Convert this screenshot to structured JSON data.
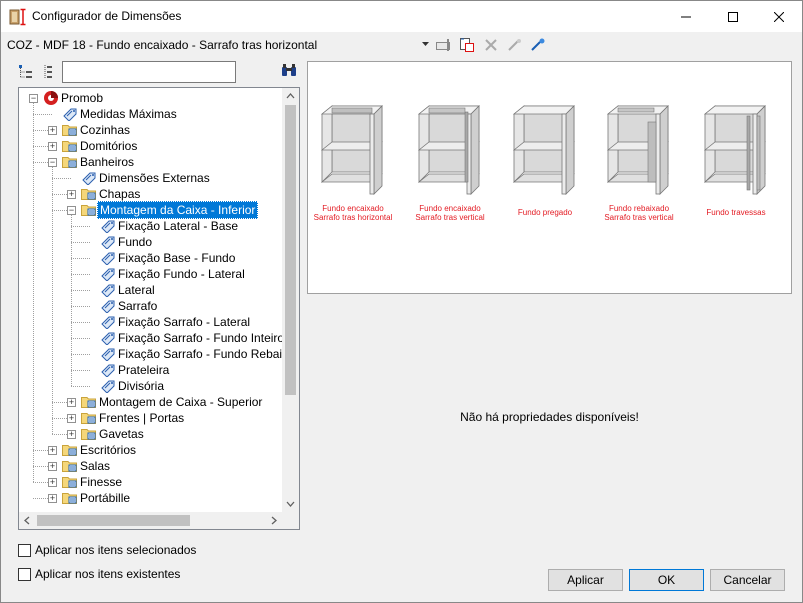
{
  "window": {
    "title": "Configurador de Dimensões"
  },
  "toolbar": {
    "combo_value": "COZ - MDF 18 - Fundo encaixado - Sarrafo tras horizontal"
  },
  "search": {
    "value": ""
  },
  "tree": {
    "items": [
      {
        "label": "Promob",
        "icon": "promob-logo-icon",
        "selected": false
      },
      {
        "label": "Medidas Máximas",
        "icon": "tag-icon"
      },
      {
        "label": "Cozinhas",
        "icon": "folder-icon"
      },
      {
        "label": "Domitórios",
        "icon": "folder-icon"
      },
      {
        "label": "Banheiros",
        "icon": "folder-icon"
      },
      {
        "label": "Dimensões Externas",
        "icon": "tag-icon"
      },
      {
        "label": "Chapas",
        "icon": "folder-icon"
      },
      {
        "label": "Montagem da Caixa - Inferior",
        "icon": "folder-icon",
        "selected": true
      },
      {
        "label": "Fixação Lateral - Base",
        "icon": "tag-icon"
      },
      {
        "label": "Fundo",
        "icon": "tag-icon"
      },
      {
        "label": "Fixação Base - Fundo",
        "icon": "tag-icon"
      },
      {
        "label": "Fixação Fundo - Lateral",
        "icon": "tag-icon"
      },
      {
        "label": "Lateral",
        "icon": "tag-icon"
      },
      {
        "label": "Sarrafo",
        "icon": "tag-icon"
      },
      {
        "label": "Fixação Sarrafo - Lateral",
        "icon": "tag-icon"
      },
      {
        "label": "Fixação Sarrafo - Fundo Inteiro",
        "icon": "tag-icon"
      },
      {
        "label": "Fixação Sarrafo - Fundo Rebaixado",
        "icon": "tag-icon"
      },
      {
        "label": "Prateleira",
        "icon": "tag-icon"
      },
      {
        "label": "Divisória",
        "icon": "tag-icon"
      },
      {
        "label": "Montagem de Caixa - Superior",
        "icon": "folder-icon"
      },
      {
        "label": "Frentes | Portas",
        "icon": "folder-icon"
      },
      {
        "label": "Gavetas",
        "icon": "folder-icon"
      },
      {
        "label": "Escritórios",
        "icon": "folder-icon"
      },
      {
        "label": "Salas",
        "icon": "folder-icon"
      },
      {
        "label": "Finesse",
        "icon": "folder-icon"
      },
      {
        "label": "Portábille",
        "icon": "folder-icon"
      }
    ]
  },
  "preview": {
    "options": [
      {
        "caption_line1": "Fundo encaixado",
        "caption_line2": "Sarrafo tras horizontal"
      },
      {
        "caption_line1": "Fundo encaixado",
        "caption_line2": "Sarrafo tras vertical"
      },
      {
        "caption_line1": "Fundo pregado",
        "caption_line2": ""
      },
      {
        "caption_line1": "Fundo rebaixado",
        "caption_line2": "Sarrafo tras vertical"
      },
      {
        "caption_line1": "Fundo travessas",
        "caption_line2": ""
      }
    ],
    "caption_color": "#e31b23"
  },
  "properties": {
    "empty_message": "Não há propriedades disponíveis!"
  },
  "options": {
    "apply_selected_label": "Aplicar nos itens selecionados",
    "apply_existing_label": "Aplicar nos itens existentes"
  },
  "buttons": {
    "apply": "Aplicar",
    "ok": "OK",
    "cancel": "Cancelar"
  },
  "colors": {
    "selection": "#0078d7",
    "accent_red": "#e31b23"
  }
}
